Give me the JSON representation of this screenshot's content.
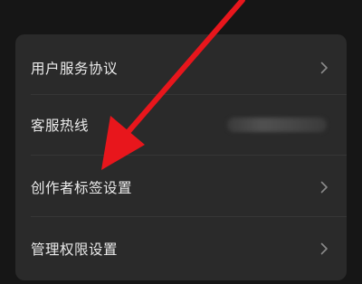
{
  "settings": {
    "items": [
      {
        "label": "用户服务协议",
        "trailing": "chevron-right-icon"
      },
      {
        "label": "客服热线",
        "trailing": "blurred-phone-number"
      },
      {
        "label": "创作者标签设置",
        "trailing": "chevron-right-icon"
      },
      {
        "label": "管理权限设置",
        "trailing": "chevron-right-icon"
      }
    ]
  },
  "annotation": {
    "arrow_color": "#e8161c",
    "points_to": "创作者标签设置"
  },
  "colors": {
    "background": "#161616",
    "card": "#2a2a2a",
    "text": "#ebebeb",
    "chevron": "#8a8a8a"
  }
}
